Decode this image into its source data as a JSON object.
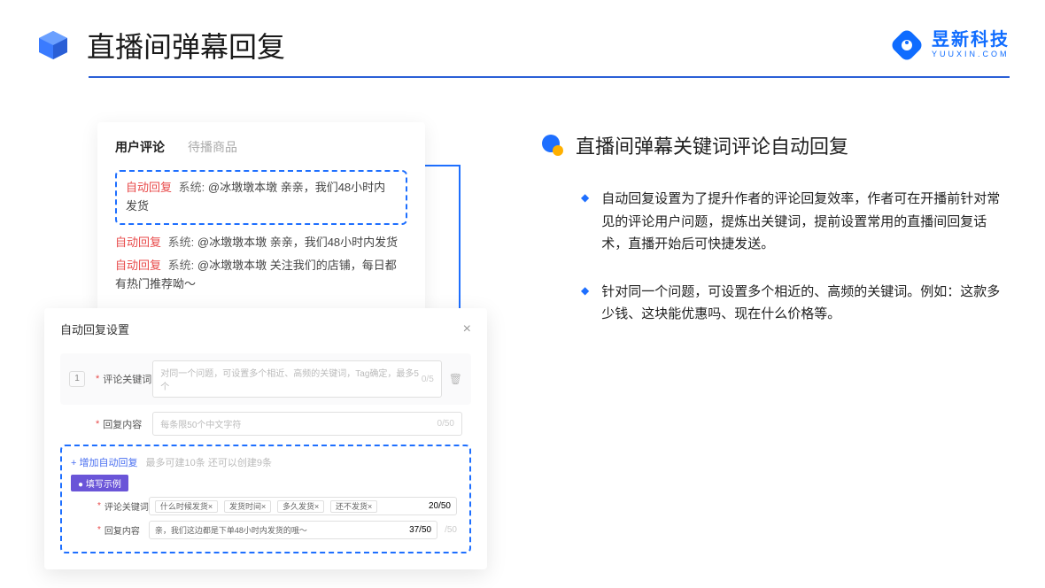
{
  "header": {
    "title": "直播间弹幕回复",
    "brand_name": "昱新科技",
    "brand_url": "YUUXIN.COM"
  },
  "comments": {
    "tab_active": "用户评论",
    "tab_inactive": "待播商品",
    "auto_badge": "自动回复",
    "system_prefix": "系统:",
    "highlight_msg": "@冰墩墩本墩 亲亲，我们48小时内发货",
    "msg2": "@冰墩墩本墩 亲亲，我们48小时内发货",
    "msg3": "@冰墩墩本墩 关注我们的店铺，每日都有热门推荐呦～"
  },
  "settings": {
    "title": "自动回复设置",
    "index": "1",
    "kw_label": "评论关键词",
    "kw_placeholder": "对同一个问题，可设置多个相近、高频的关键词，Tag确定，最多5个",
    "kw_counter": "0/5",
    "reply_label": "回复内容",
    "reply_placeholder": "每条限50个中文字符",
    "reply_counter": "0/50",
    "add_link": "+ 增加自动回复",
    "add_hint": "最多可建10条 还可以创建9条",
    "demo_badge": "● 填写示例",
    "ex_kw_label": "评论关键词",
    "ex_tags": [
      "什么时候发货×",
      "发货时间×",
      "多久发货×",
      "还不发货×"
    ],
    "ex_kw_counter": "20/50",
    "ex_reply_label": "回复内容",
    "ex_reply_text": "亲，我们这边都是下单48小时内发货的哦～",
    "ex_reply_counter": "37/50",
    "outer_counter": "/50"
  },
  "feature": {
    "title": "直播间弹幕关键词评论自动回复",
    "bullet1": "自动回复设置为了提升作者的评论回复效率，作者可在开播前针对常见的评论用户问题，提炼出关键词，提前设置常用的直播间回复话术，直播开始后可快捷发送。",
    "bullet2": "针对同一个问题，可设置多个相近的、高频的关键词。例如：这款多少钱、这块能优惠吗、现在什么价格等。"
  }
}
